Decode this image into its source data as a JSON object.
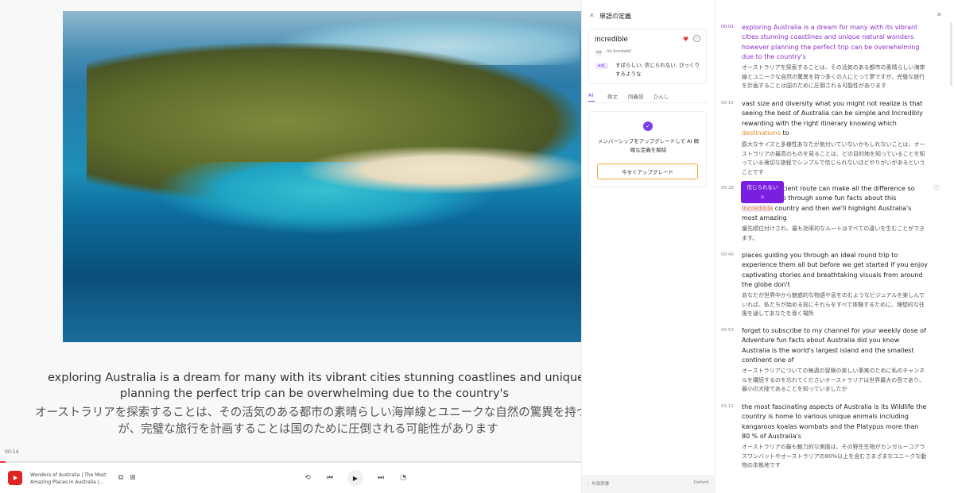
{
  "player": {
    "subtitle_en": "exploring Australia is a dream for many with its vibrant cities stunning coastlines and unique natural wonders however planning the perfect trip can be overwhelming due to the country's",
    "subtitle_en_line1": "exploring Australia is a dream for many with its vibrant cities stunning coastlines and unique natural wonders however",
    "subtitle_en_line2": "planning the perfect trip can be overwhelming due to the country's",
    "subtitle_ja_line1": "オーストラリアを探索することは、その活気のある都市の素晴らしい海岸線とユニークな自然の驚異を持つ多くの人にとって夢ですが、完璧な旅",
    "subtitle_ja_line2": "が、完璧な旅行を計画することは国のために圧倒される可能性があります",
    "current_time": "00:14",
    "progress_fraction": 0.01,
    "track_title": "Wonders of Australia | The Most Amazing Places in Australia |...",
    "controls": {
      "loop_icon": "loop-icon",
      "prev_icon": "skip-previous-icon",
      "play_icon": "play-icon",
      "next_icon": "skip-next-icon",
      "speed_icon": "speed-icon"
    }
  },
  "dictionary": {
    "title": "単語の定義",
    "word": "incredible",
    "region": "us",
    "ipa": "/ɪnˈkredəbl/",
    "pos": "adj.",
    "meaning": "すばらしい; 信じられない; びっくりするような",
    "tabs": [
      {
        "label": "AI",
        "active": true
      },
      {
        "label": "例文",
        "active": false
      },
      {
        "label": "同義語",
        "active": false
      },
      {
        "label": "ひんし",
        "active": false
      }
    ],
    "upsell_message": "メンバーシップをアップグレードして AI 精確な定義を解除",
    "upsell_button": "今すぐアップグレード",
    "footer_source": "外部辞書",
    "footer_provider": "Oxford"
  },
  "transcript": {
    "popup_label": "信じられない",
    "segments": [
      {
        "time": "00:01",
        "active": true,
        "en": "exploring Australia is a dream for many with its vibrant cities stunning coastlines and unique natural wonders however planning the perfect trip can be overwhelming due to the country's",
        "ja": "オーストラリアを探索することは、その活気のある都市の素晴らしい海岸線とユニークな自然の驚異を持つ多くの人にとって夢ですが、完璧な旅行を計画することは国のために圧倒される可能性があります"
      },
      {
        "time": "00:15",
        "active": false,
        "en_pre": "vast size and diversity what you might not realize is that seeing the best of Australia can be simple and Incredibly rewarding with the right itinerary knowing which ",
        "en_hl": "destinations",
        "en_post": " to",
        "ja": "膨大なサイズと多様性あなたが気付いていないかもしれないことは、オーストラリアの最高のものを見ることは、どの目的地を知っていることを知っている適切な旅程でシンプルで信じられないほどやりがいがあるということです"
      },
      {
        "time": "00:28",
        "active": false,
        "en_pre": "the most efficient route can make all the difference so today we'll go through some fun facts about this ",
        "en_hl": "incredible",
        "en_post": " country and then we'll highlight Australia's most amazing",
        "ja": "優先順位付けされ、最も効率的なルートはすべての違いを生むことができます。"
      },
      {
        "time": "00:40",
        "active": false,
        "en": "places guiding you through an ideal round trip to experience them all but before we get started if you enjoy captivating stories and breathtaking visuals from around the globe don't",
        "ja": "あなたが世界中から魅惑的な物語や息をのむようなビジュアルを楽しんでいれば、私たちが始める前にそれらをすべて体験するために、理想的な往復を通してあなたを導く場所"
      },
      {
        "time": "00:53",
        "active": false,
        "en": "forget to subscribe to my channel for your weekly dose of Adventure fun facts about Australia did you know Australia is the world's largest island and the smallest continent one of",
        "ja": "オーストラリアについての毎週の冒険の楽しい事実のために私のチャンネルを購読するのを忘れてくださいオーストラリアは世界最大の島であり、最小の大陸であることを知っていましたか"
      },
      {
        "time": "01:11",
        "active": false,
        "en": "the most fascinating aspects of Australia is its Wildlife the country is home to various unique animals including kangaroos koalas wombats and the Platypus more than 80 % of Australia's",
        "ja": "オーストラリアの最も魅力的な側面は、その野生生物がカンガルーコアラスワンバットやオーストラリアの80%以上を含むさまざまなユニークな動物の本拠地です"
      }
    ]
  }
}
